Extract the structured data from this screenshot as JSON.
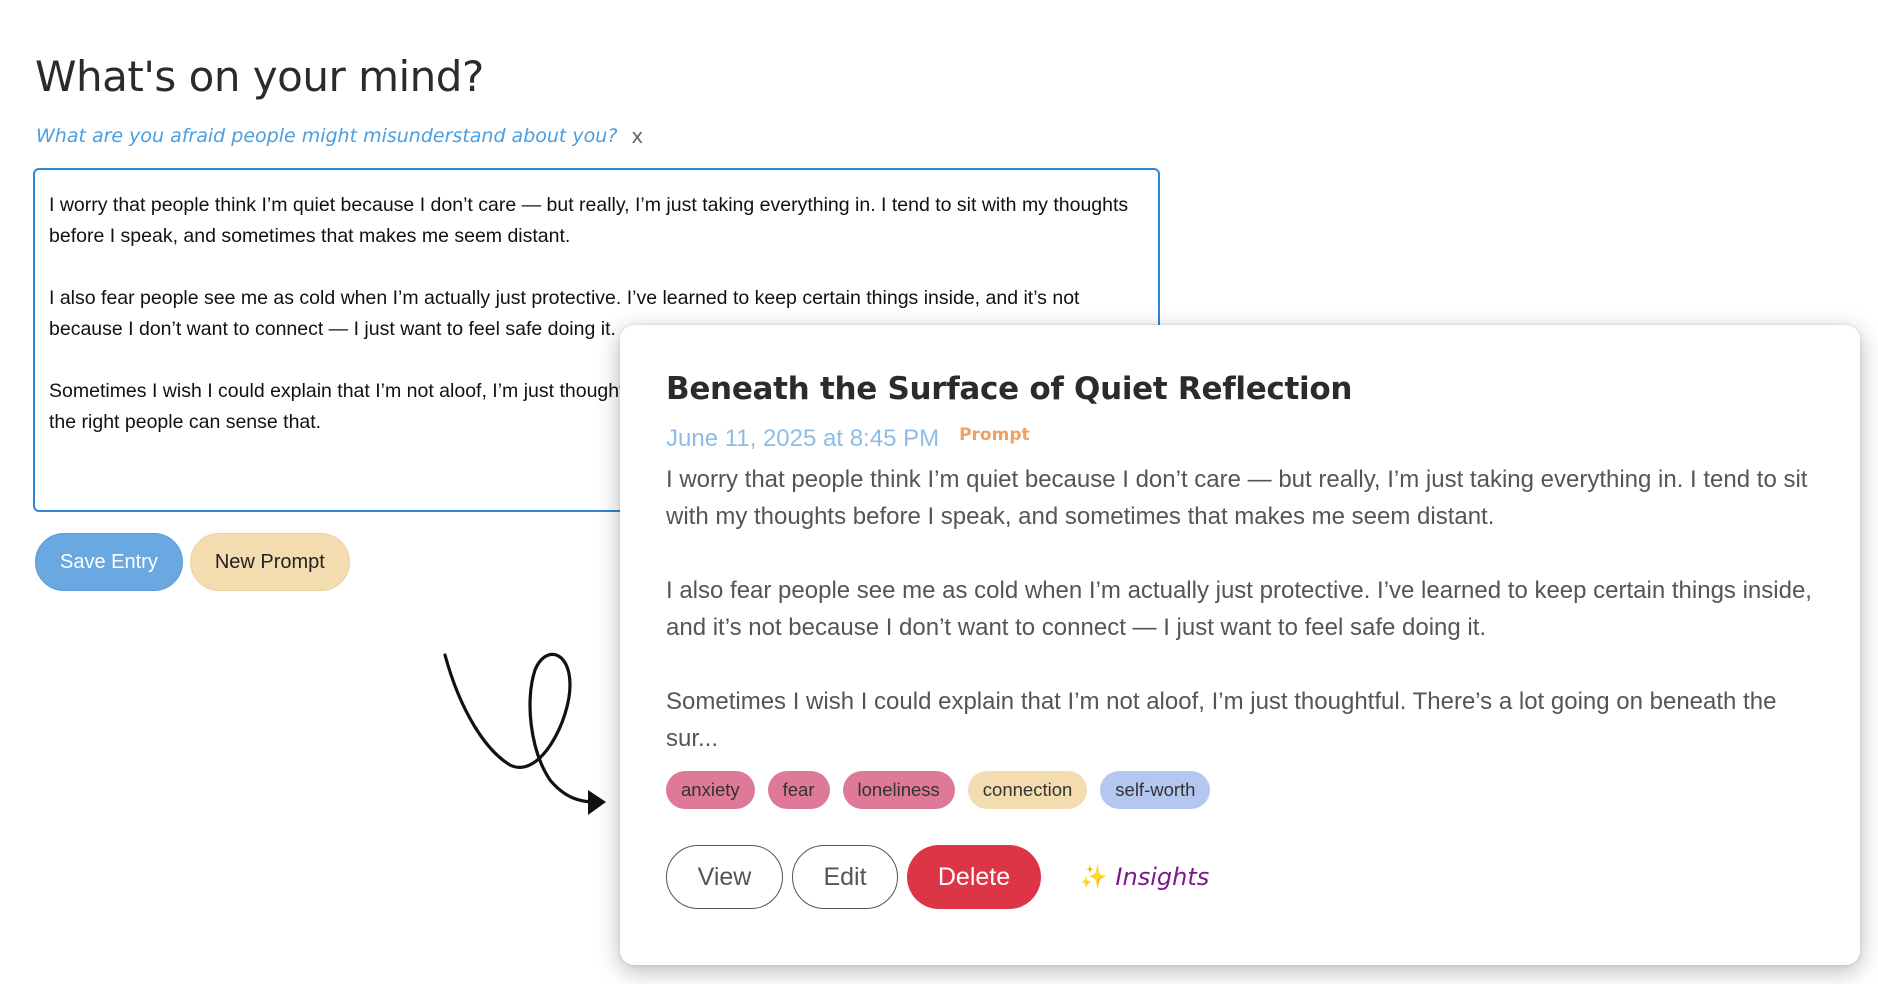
{
  "editor": {
    "title": "What's on your mind?",
    "prompt": "What are you afraid people might misunderstand about you?",
    "prompt_close": "x",
    "paragraphs": [
      "I worry that people think I’m quiet because I don’t care — but really, I’m just taking everything in. I tend to sit with my thoughts before I speak, and sometimes that makes me seem distant.",
      "I also fear people see me as cold when I’m actually just protective. I’ve learned to keep certain things inside, and it’s not because I don’t want to connect — I just want to feel safe doing it.",
      "Sometimes I wish I could explain that I’m not aloof, I’m just thoughtful. There’s a lot going on beneath the surface, and I hope the right people can sense that."
    ],
    "save_label": "Save Entry",
    "new_prompt_label": "New Prompt"
  },
  "card": {
    "title": "Beneath the Surface of Quiet Reflection",
    "date": "June 11, 2025 at 8:45 PM",
    "badge": "Prompt",
    "paragraphs": [
      "I worry that people think I’m quiet because I don’t care — but really, I’m just taking everything in. I tend to sit with my thoughts before I speak, and sometimes that makes me seem distant.",
      "I also fear people see me as cold when I’m actually just protective. I’ve learned to keep certain things inside, and it’s not because I don’t want to connect — I just want to feel safe doing it.",
      "Sometimes I wish I could explain that I’m not aloof, I’m just thoughtful. There’s a lot going on beneath the sur..."
    ],
    "tags": [
      {
        "label": "anxiety",
        "color": "#de7a98"
      },
      {
        "label": "fear",
        "color": "#de7a98"
      },
      {
        "label": "loneliness",
        "color": "#de7a98"
      },
      {
        "label": "connection",
        "color": "#f3dcb0"
      },
      {
        "label": "self-worth",
        "color": "#b5c7f0"
      }
    ],
    "view_label": "View",
    "edit_label": "Edit",
    "delete_label": "Delete",
    "insights_icon": "sparkles-icon",
    "insights_label": "Insights"
  },
  "colors": {
    "accent_blue": "#2f86d6",
    "delete_red": "#dc3545",
    "insights_purple": "#7a1a8a",
    "badge_orange": "#f0a060"
  }
}
